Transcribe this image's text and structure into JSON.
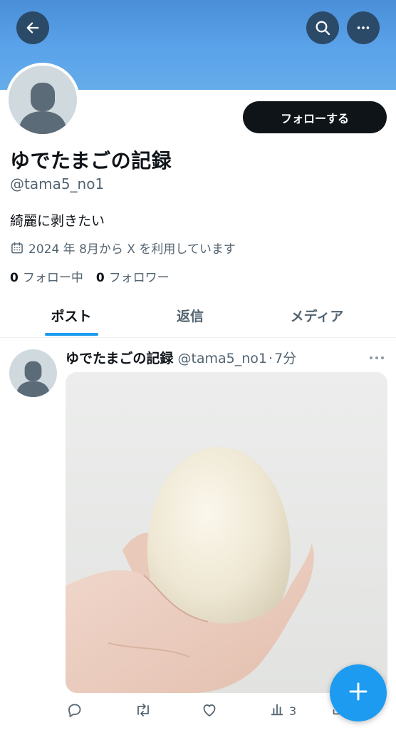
{
  "header": {
    "back_icon": "arrow-left-icon",
    "search_icon": "search-icon",
    "more_icon": "more-horizontal-icon",
    "banner_color": "#5ba3ea"
  },
  "profile": {
    "display_name": "ゆでたまごの記録",
    "handle": "@tama5_no1",
    "bio": "綺麗に剥きたい",
    "joined": "2024 年 8月から X を利用しています",
    "follow_button": "フォローする",
    "following_count": "0",
    "following_label": "フォロー中",
    "followers_count": "0",
    "followers_label": "フォロワー"
  },
  "tabs": [
    {
      "label": "ポスト",
      "active": true
    },
    {
      "label": "返信",
      "active": false
    },
    {
      "label": "メディア",
      "active": false
    }
  ],
  "post": {
    "author_name": "ゆでたまごの記録",
    "author_handle": "@tama5_no1",
    "separator": "·",
    "time": "7分",
    "image_alt": "peeled boiled egg held in hand",
    "actions": {
      "reply_icon": "reply-icon",
      "repost_icon": "repost-icon",
      "like_icon": "heart-icon",
      "views_icon": "views-chart-icon",
      "views_count": "3",
      "share_icon": "share-icon"
    }
  },
  "fab": {
    "icon": "plus-icon",
    "color": "#1d9bf0"
  },
  "colors": {
    "accent": "#1d9bf0",
    "text": "#0f1419",
    "muted": "#536471"
  }
}
